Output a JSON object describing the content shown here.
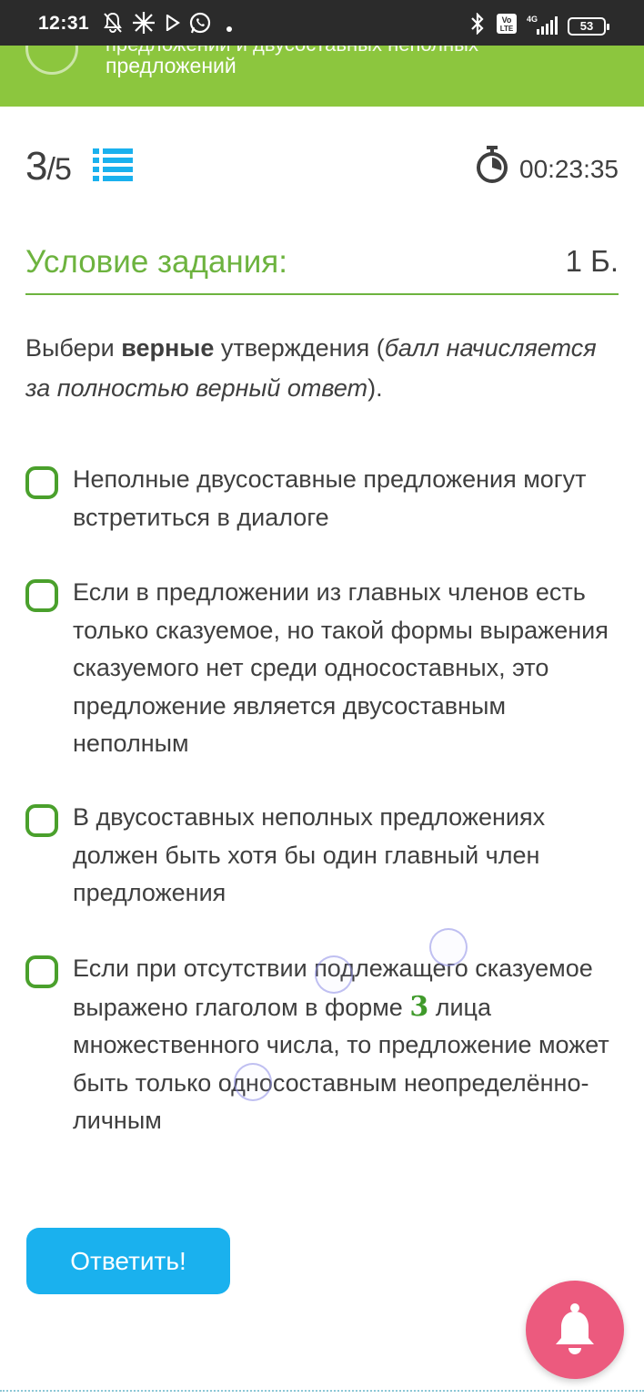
{
  "status_bar": {
    "time": "12:31",
    "battery": "53",
    "network": "4G",
    "volte": "Vo LTE"
  },
  "header": {
    "title_line1": "предложений и двусоставных неполных",
    "title_line2": "предложений",
    "color": "#8cc63e"
  },
  "progress": {
    "current": "3",
    "total": "5"
  },
  "timer": {
    "value": "00:23:35"
  },
  "condition": {
    "title": "Условие задания:",
    "points": "1 Б."
  },
  "question": {
    "part1": "Выбери ",
    "bold": "верные",
    "part2": " утверждения (",
    "italic": "балл начисляется за полностью верный ответ",
    "part3": ")."
  },
  "options": [
    {
      "text": "Неполные двусоставные предложения могут встретиться в диалоге"
    },
    {
      "text": "Если в предложении из главных членов есть только сказуемое, но такой формы выражения сказуемого нет среди односоставных, это предложение является двусоставным неполным"
    },
    {
      "text": "В двусоставных неполных предложениях должен быть хотя бы один главный член предложения"
    },
    {
      "text_before": "Если при отсутствии подлежащего сказуемое выражено глаголом в форме ",
      "number": "3",
      "text_after": " лица множественного числа, то предложение может быть только односоставным неопределённо-личным"
    }
  ],
  "answer_button": {
    "label": "Ответить!",
    "color": "#1ab1ee"
  },
  "colors": {
    "accent_green": "#6db33f",
    "checkbox_green": "#4aa02c",
    "bell": "#ec5a7e"
  }
}
